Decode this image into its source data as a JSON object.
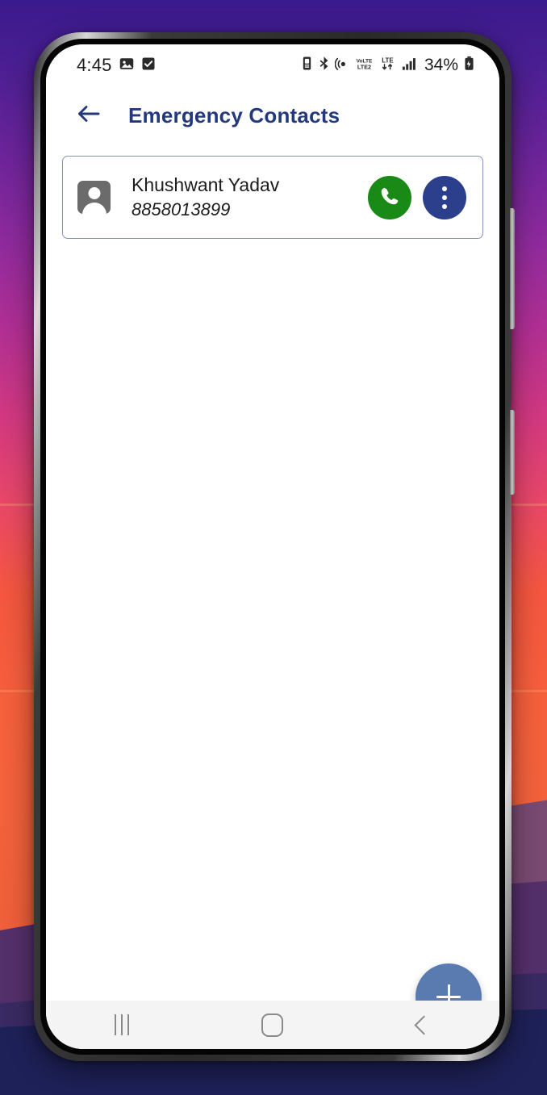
{
  "wallpaper": {
    "description": "sunset-gradient-mountains",
    "colors": {
      "top": "#3a1a8c",
      "mid": "#d13880",
      "sun": "#f4563f",
      "mountain_1": "#7a4a72",
      "mountain_2": "#54306b",
      "mountain_3": "#3a2a63",
      "mountain_4": "#1e2158"
    }
  },
  "status_bar": {
    "clock": "4:45",
    "left_icons": [
      "image-icon",
      "checkbox-checked-icon"
    ],
    "right_icons": [
      "alarm-icon",
      "bluetooth-icon",
      "hotspot-icon",
      "volte2-icon",
      "lte-data-arrows-icon",
      "signal-bars-icon"
    ],
    "battery_percent": "34%",
    "battery_icon": "battery-saver-icon",
    "volte_label": "VoLTE",
    "volte_sub": "LTE2",
    "lte_label": "LTE"
  },
  "app_bar": {
    "back_icon": "arrow-left-icon",
    "title": "Emergency Contacts",
    "title_color": "#23397c"
  },
  "contacts": [
    {
      "avatar_icon": "contact-avatar-icon",
      "name": "Khushwant Yadav",
      "phone": "8858013899",
      "call_icon": "phone-call-icon",
      "call_color": "#1a8a16",
      "menu_icon": "overflow-menu-icon",
      "menu_color": "#2b3f8c"
    }
  ],
  "fab": {
    "icon": "plus-icon",
    "label": "+",
    "color": "#5a7bb0"
  },
  "nav_bar": {
    "recents_icon": "recents-icon",
    "home_icon": "home-icon",
    "back_icon": "back-chevron-icon"
  }
}
